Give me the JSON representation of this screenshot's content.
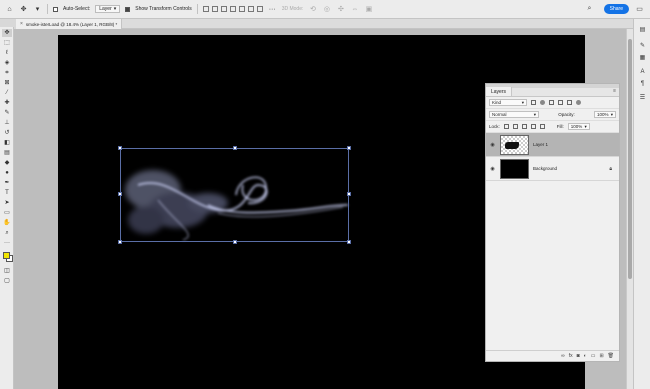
{
  "options_bar": {
    "auto_select_label": "Auto-Select:",
    "auto_select_checked": false,
    "layer_dropdown": "Layer",
    "show_transform_label": "Show Transform Controls",
    "show_transform_checked": true,
    "mode_3d_label": "3D Mode:",
    "share_label": "Share"
  },
  "document_tab": {
    "title": "smoke-isterLoad @ 18.4% (Layer 1, RGB/8) *"
  },
  "toolbar": {
    "tools": [
      "move-tool",
      "artboard-tool",
      "marquee-tool",
      "lasso-tool",
      "object-select-tool",
      "crop-tool",
      "frame-tool",
      "eyedropper-tool",
      "healing-brush-tool",
      "brush-tool",
      "clone-stamp-tool",
      "history-brush-tool",
      "eraser-tool",
      "gradient-tool",
      "blur-tool",
      "dodge-tool",
      "pen-tool",
      "type-tool",
      "path-select-tool",
      "rectangle-tool",
      "hand-tool",
      "zoom-tool",
      "more-tools"
    ],
    "foreground_color": "#f2e600",
    "background_color": "#ffffff"
  },
  "layers_panel": {
    "tab_label": "Layers",
    "filter_kind": "Kind",
    "blend_mode": "Normal",
    "opacity_label": "Opacity:",
    "opacity_value": "100%",
    "lock_label": "Lock:",
    "fill_label": "Fill:",
    "fill_value": "100%",
    "layers": [
      {
        "name": "Layer 1",
        "selected": true,
        "locked": false
      },
      {
        "name": "Background",
        "selected": false,
        "locked": true
      }
    ]
  },
  "colors": {
    "accent": "#1473e6",
    "canvas": "#000000",
    "selected_layer": "#b4b4b4"
  }
}
